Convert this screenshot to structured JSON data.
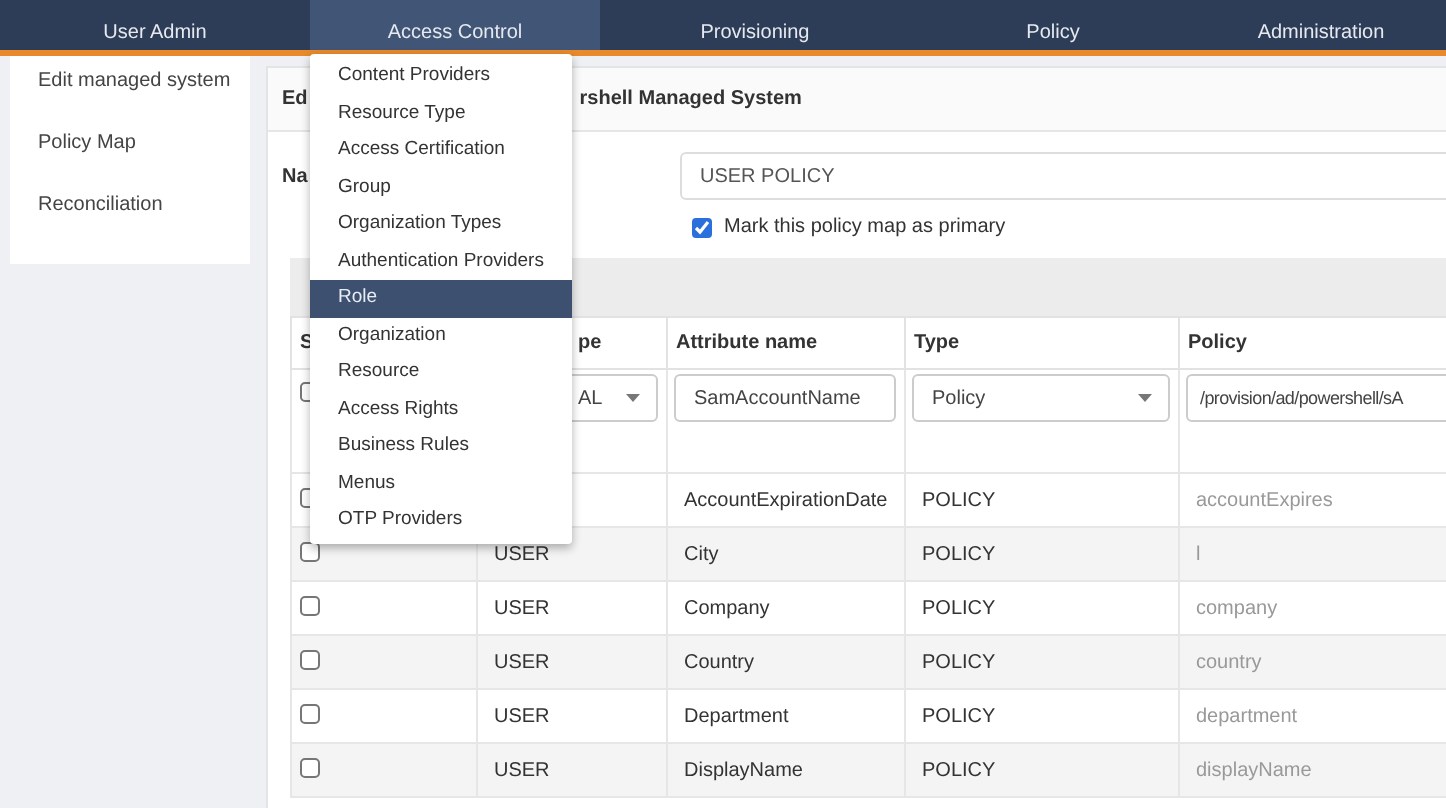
{
  "nav": {
    "tabs": [
      {
        "label": "User Admin",
        "selected": false
      },
      {
        "label": "Access Control",
        "selected": true
      },
      {
        "label": "Provisioning",
        "selected": false
      },
      {
        "label": "Policy",
        "selected": false
      },
      {
        "label": "Administration",
        "selected": false
      }
    ]
  },
  "sidebar": {
    "items": [
      "Edit managed system",
      "Policy Map",
      "Reconciliation"
    ]
  },
  "panel": {
    "title_start": "Ed",
    "title_end": "rshell Managed System",
    "name_label": "Na",
    "name_value": "USER POLICY",
    "primary": {
      "label": "Mark this policy map as primary",
      "checked": true
    }
  },
  "table": {
    "columns": [
      "S",
      "pe",
      "Attribute name",
      "Type",
      "Policy"
    ],
    "filter": {
      "checked": false,
      "entity": "AL",
      "attribute": "SamAccountName",
      "type": "Policy",
      "policy": "/provision/ad/powershell/sA"
    },
    "rows": [
      {
        "checked": false,
        "attribute": "AccountExpirationDate",
        "type": "POLICY",
        "policy": "accountExpires"
      },
      {
        "checked": false,
        "entity": "USER",
        "attribute": "City",
        "type": "POLICY",
        "policy": "l"
      },
      {
        "checked": false,
        "entity": "USER",
        "attribute": "Company",
        "type": "POLICY",
        "policy": "company"
      },
      {
        "checked": false,
        "entity": "USER",
        "attribute": "Country",
        "type": "POLICY",
        "policy": "country"
      },
      {
        "checked": false,
        "entity": "USER",
        "attribute": "Department",
        "type": "POLICY",
        "policy": "department"
      },
      {
        "checked": false,
        "entity": "USER",
        "attribute": "DisplayName",
        "type": "POLICY",
        "policy": "displayName"
      }
    ]
  },
  "menu": {
    "items": [
      {
        "label": "Content Providers",
        "selected": false
      },
      {
        "label": "Resource Type",
        "selected": false
      },
      {
        "label": "Access Certification",
        "selected": false
      },
      {
        "label": "Group",
        "selected": false
      },
      {
        "label": "Organization Types",
        "selected": false
      },
      {
        "label": "Authentication Providers",
        "selected": false
      },
      {
        "label": "Role",
        "selected": true
      },
      {
        "label": "Organization",
        "selected": false
      },
      {
        "label": "Resource",
        "selected": false
      },
      {
        "label": "Access Rights",
        "selected": false
      },
      {
        "label": "Business Rules",
        "selected": false
      },
      {
        "label": "Menus",
        "selected": false
      },
      {
        "label": "OTP Providers",
        "selected": false
      }
    ]
  }
}
